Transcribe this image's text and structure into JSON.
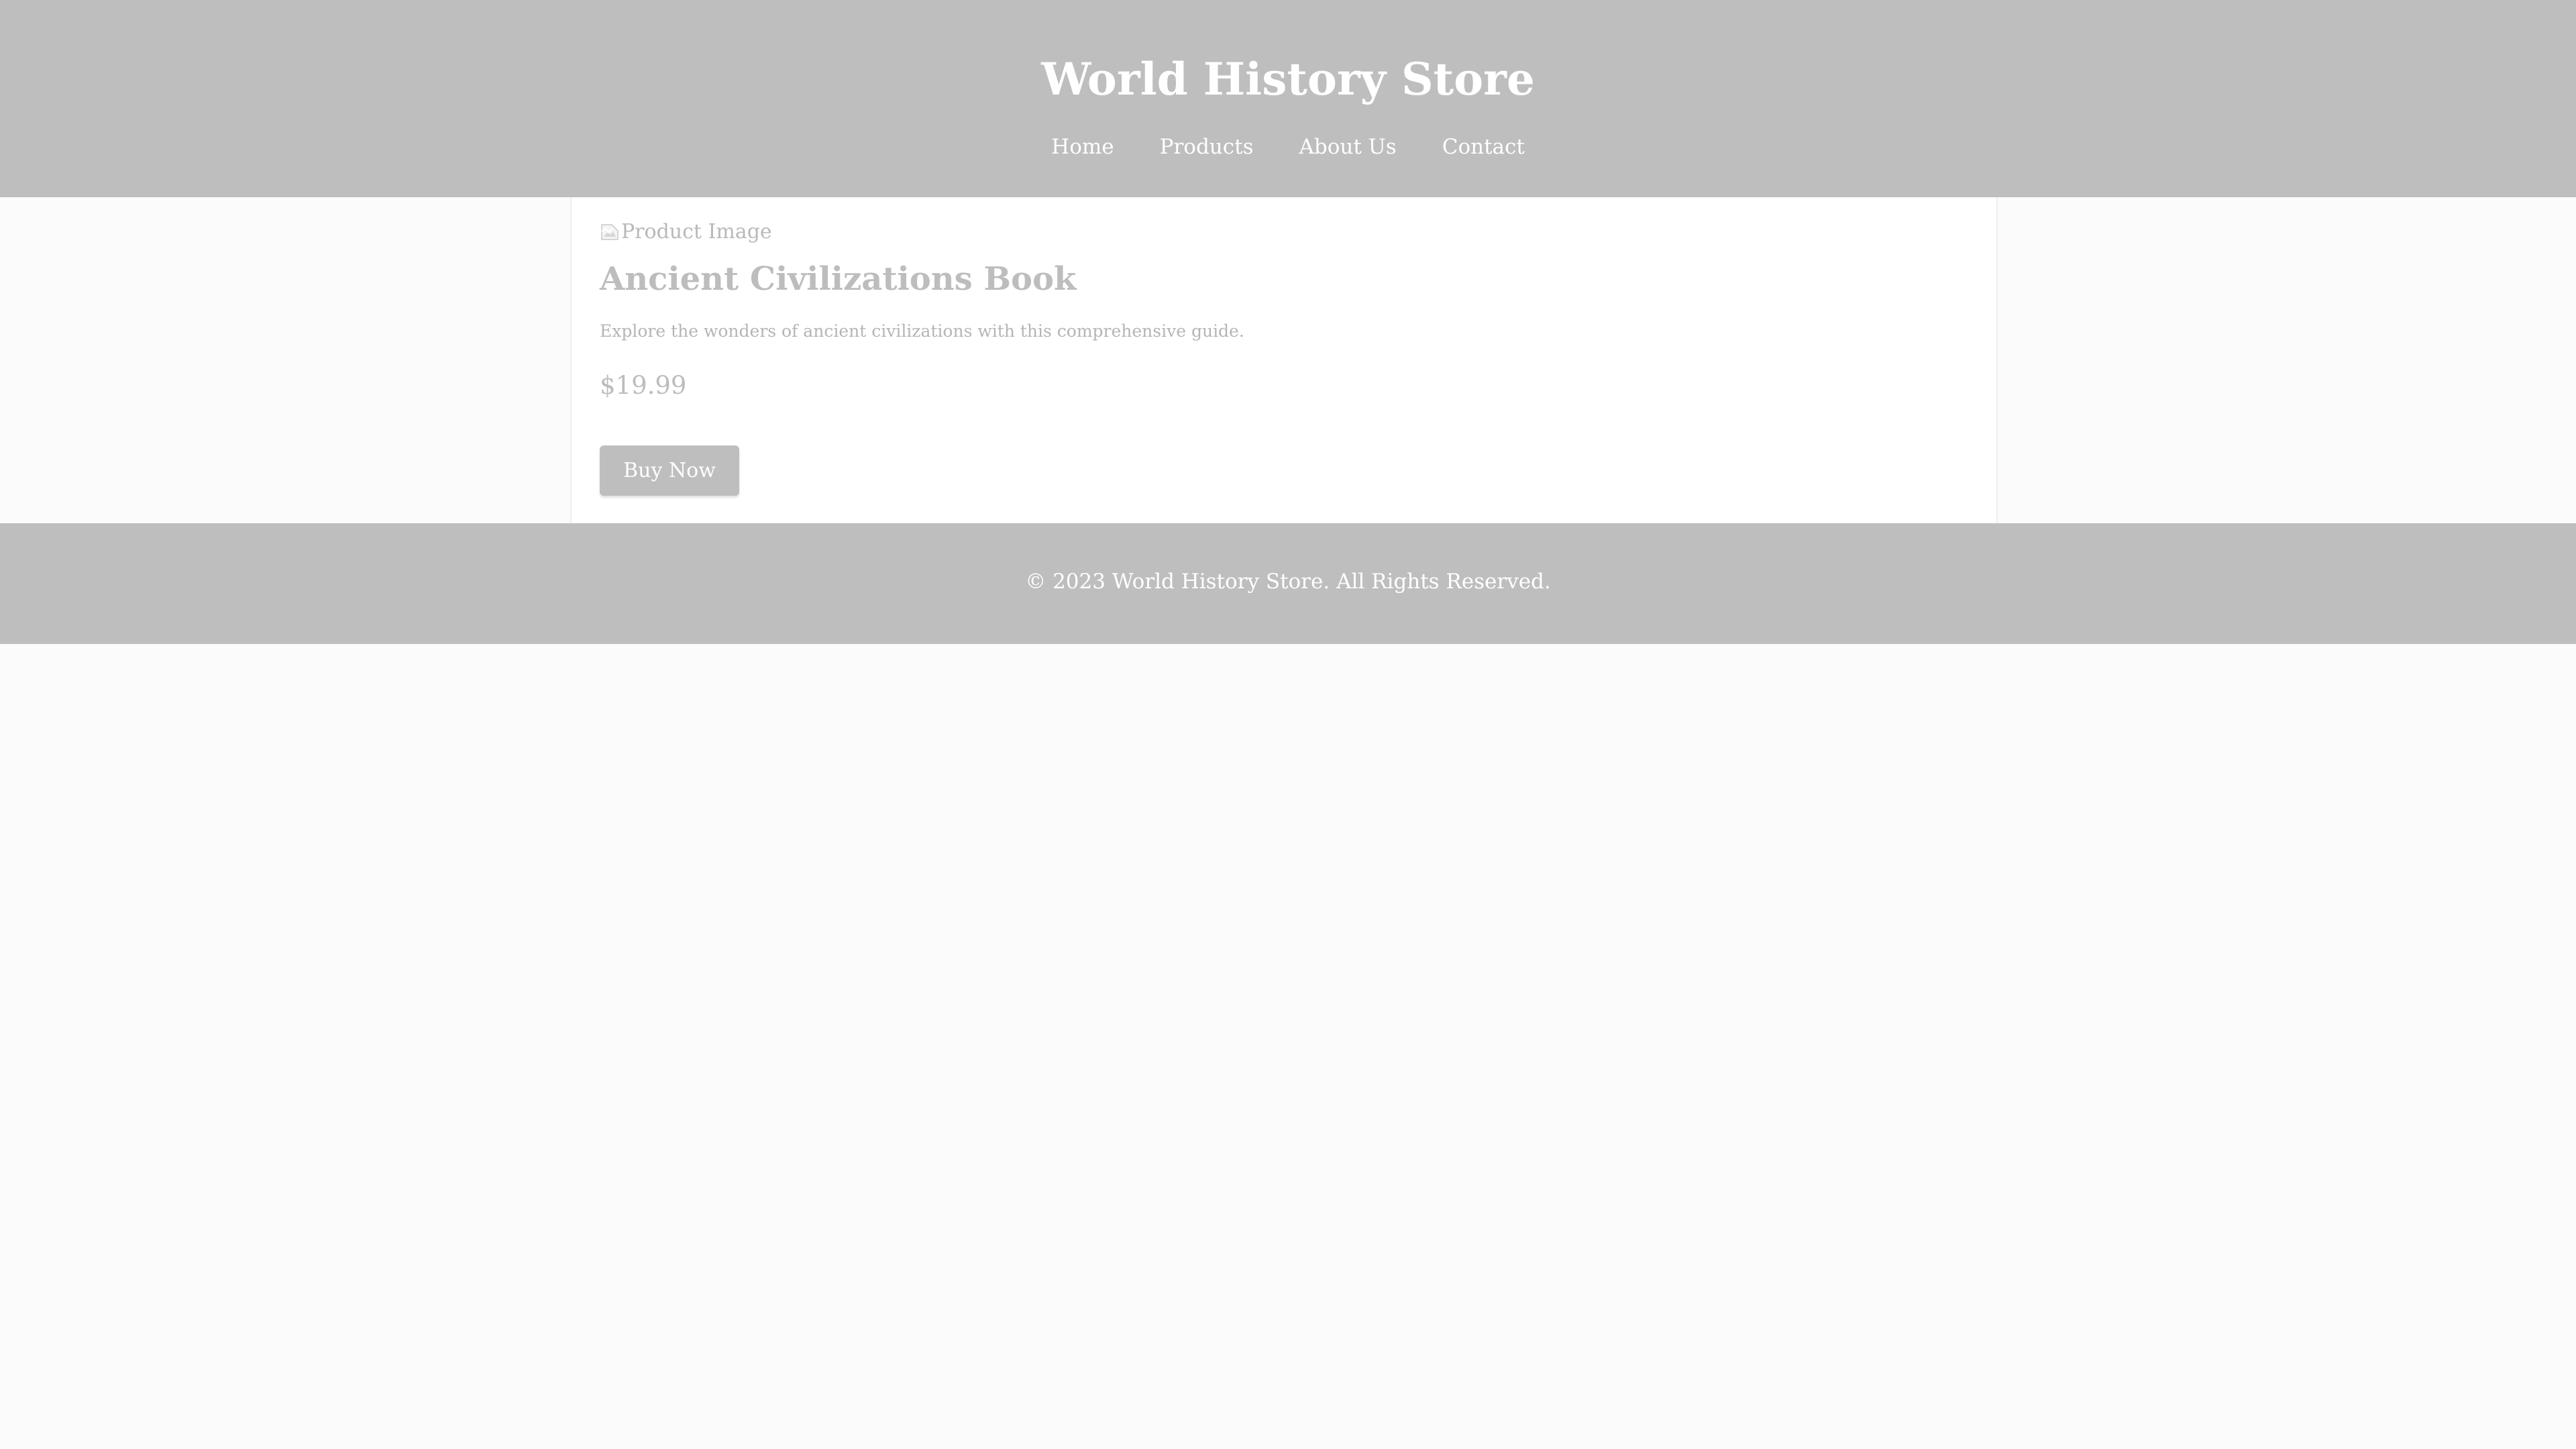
{
  "header": {
    "title": "World History Store",
    "nav": [
      {
        "label": "Home"
      },
      {
        "label": "Products"
      },
      {
        "label": "About Us"
      },
      {
        "label": "Contact"
      }
    ]
  },
  "product": {
    "image_alt": "Product Image",
    "name": "Ancient Civilizations Book",
    "description": "Explore the wonders of ancient civilizations with this comprehensive guide.",
    "price": "$19.99",
    "buy_label": "Buy Now"
  },
  "footer": {
    "text": "© 2023 World History Store. All Rights Reserved."
  },
  "colors": {
    "header_bg": "#bebebe",
    "page_bg": "#fbfbfb",
    "panel_bg": "#ffffff",
    "button_bg": "#bebebe",
    "muted_text": "#bdbdbd"
  }
}
